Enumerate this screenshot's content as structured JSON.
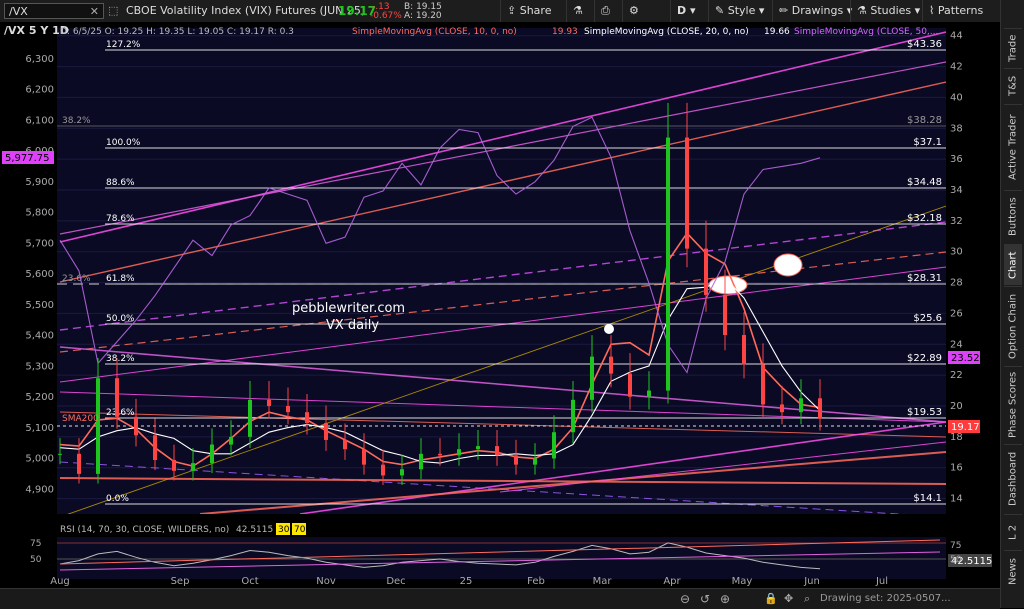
{
  "toolbar": {
    "symbol": "/VX",
    "description": "CBOE Volatility Index (VIX) Futures (JUN 25)",
    "last": "19.17",
    "change": "-.13",
    "change_pct": "-0.67%",
    "bid": "B: 19.15",
    "ask": "A: 19.20",
    "share": "Share",
    "period": "D",
    "style": "Style",
    "drawings": "Drawings",
    "studies": "Studies",
    "patterns": "Patterns",
    "colors": {
      "up": "#1ec51e",
      "down": "#ff4444",
      "accent": "#4a90e2"
    }
  },
  "header": {
    "title": "/VX 5 Y 1D",
    "ohlc": "D: 6/5/25  O: 19.25  H: 19.35  L: 19.05  C: 19.17  R: 0.3",
    "sma10": "SimpleMovingAvg (CLOSE, 10, 0, no)",
    "sma10_val": "19.93",
    "sma20": "SimpleMovingAvg (CLOSE, 20, 0, no)",
    "sma20_val": "19.66",
    "sma50": "SimpleMovingAvg (CLOSE, 50,..."
  },
  "right_tabs": [
    "Trade",
    "T&S",
    "Active Trader",
    "Buttons",
    "Chart",
    "Option Chain",
    "Phase Scores",
    "Dashboard",
    "L 2",
    "News"
  ],
  "annotations": {
    "watermark_line1": "pebblewriter.com",
    "watermark_line2": "VX daily",
    "sma200": "SMA200"
  },
  "fib_levels_left": [
    "127.2%",
    "100.0%",
    "88.6%",
    "78.6%",
    "61.8%",
    "50.0%",
    "38.2%",
    "23.6%",
    "0.0%"
  ],
  "fib_levels_right": [
    "$43.36",
    "$37.1",
    "$34.48",
    "$32.18",
    "$28.31",
    "$25.6",
    "$22.89",
    "$19.53",
    "$14.1"
  ],
  "fib_extra": {
    "left_382": "38.2%",
    "right_3828": "$38.28",
    "left_236": "23.6%"
  },
  "price_badges": {
    "spx": "5,977.75",
    "sma": "23.52",
    "last": "19.17"
  },
  "rsi": {
    "label": "RSI (14, 70, 30, CLOSE, WILDERS, no)",
    "value": "42.5115",
    "ob": "30",
    "os": "70",
    "right_value": "42.5115",
    "ticks_left": [
      "75",
      "50"
    ],
    "ticks_right": [
      "75",
      "50"
    ]
  },
  "bottom": {
    "drawing_set": "Drawing set: 2025-0507..."
  },
  "chart_data": {
    "type": "line",
    "title": "/VX 5 Y 1D",
    "x_ticks": [
      "Aug",
      "Sep",
      "Oct",
      "Nov",
      "Dec",
      "25",
      "Feb",
      "Mar",
      "Apr",
      "May",
      "Jun",
      "Jul"
    ],
    "left_axis": {
      "label": "SPX",
      "range": [
        4820,
        6400
      ],
      "ticks": [
        "6,300",
        "6,200",
        "6,100",
        "6,000",
        "5,900",
        "5,800",
        "5,700",
        "5,600",
        "5,500",
        "5,400",
        "5,300",
        "5,200",
        "5,100",
        "5,000",
        "4,900"
      ]
    },
    "right_axis": {
      "label": "VX",
      "range": [
        13,
        44.5
      ],
      "ticks": [
        "44",
        "42",
        "40",
        "38",
        "36",
        "34",
        "32",
        "30",
        "28",
        "26",
        "24",
        "22",
        "20",
        "18",
        "16",
        "14"
      ]
    },
    "series": [
      {
        "name": "SimpleMovingAvg (CLOSE, 10, 0, no)",
        "color": "#ff6b5b",
        "values": [
          17.5,
          17.4,
          19.1,
          19.2,
          18.5,
          17.3,
          16.4,
          16.1,
          16.9,
          17.9,
          19.0,
          19.6,
          19.3,
          19.1,
          18.4,
          17.8,
          17.2,
          16.4,
          16.2,
          16.5,
          16.7,
          16.9,
          17.1,
          17.0,
          16.7,
          16.6,
          17.2,
          18.6,
          21.4,
          24.0,
          24.1,
          23.3,
          29.4,
          31.2,
          29.9,
          29.2,
          26.3,
          22.5,
          21.2,
          20.1,
          19.9
        ]
      },
      {
        "name": "SimpleMovingAvg (CLOSE, 20, 0, no)",
        "color": "#ffffff",
        "values": [
          17.3,
          17.2,
          18.0,
          18.4,
          18.6,
          18.2,
          17.9,
          17.1,
          16.9,
          16.9,
          17.6,
          18.3,
          18.6,
          18.8,
          18.6,
          18.3,
          17.7,
          17.1,
          16.8,
          16.4,
          16.3,
          16.6,
          16.8,
          16.8,
          16.9,
          16.8,
          16.9,
          17.5,
          19.4,
          21.6,
          22.2,
          22.6,
          25.6,
          27.6,
          27.7,
          28.3,
          27.0,
          24.8,
          22.6,
          20.9,
          19.7
        ]
      },
      {
        "name": "SPX",
        "color": "#b566e0",
        "values": [
          5710,
          5610,
          5310,
          5380,
          5450,
          5530,
          5620,
          5710,
          5660,
          5760,
          5790,
          5880,
          5860,
          5840,
          5700,
          5720,
          5850,
          5870,
          5960,
          5890,
          6010,
          6070,
          6060,
          5920,
          5860,
          5900,
          5970,
          6080,
          6110,
          5980,
          5740,
          5570,
          5370,
          5280,
          5520,
          5640,
          5860,
          5940,
          5950,
          5960,
          5978
        ]
      }
    ],
    "vx_candles_close": [
      16.9,
      15.6,
      21.8,
      19.3,
      18.1,
      16.5,
      15.8,
      16.3,
      17.5,
      18.0,
      20.4,
      20.0,
      19.6,
      18.9,
      17.8,
      17.2,
      16.2,
      15.5,
      15.9,
      16.9,
      16.8,
      17.2,
      17.4,
      16.8,
      16.2,
      16.6,
      18.3,
      20.4,
      23.2,
      22.1,
      20.6,
      21.0,
      37.4,
      30.2,
      27.2,
      24.6,
      22.7,
      20.1,
      19.6,
      20.5,
      19.17
    ]
  }
}
